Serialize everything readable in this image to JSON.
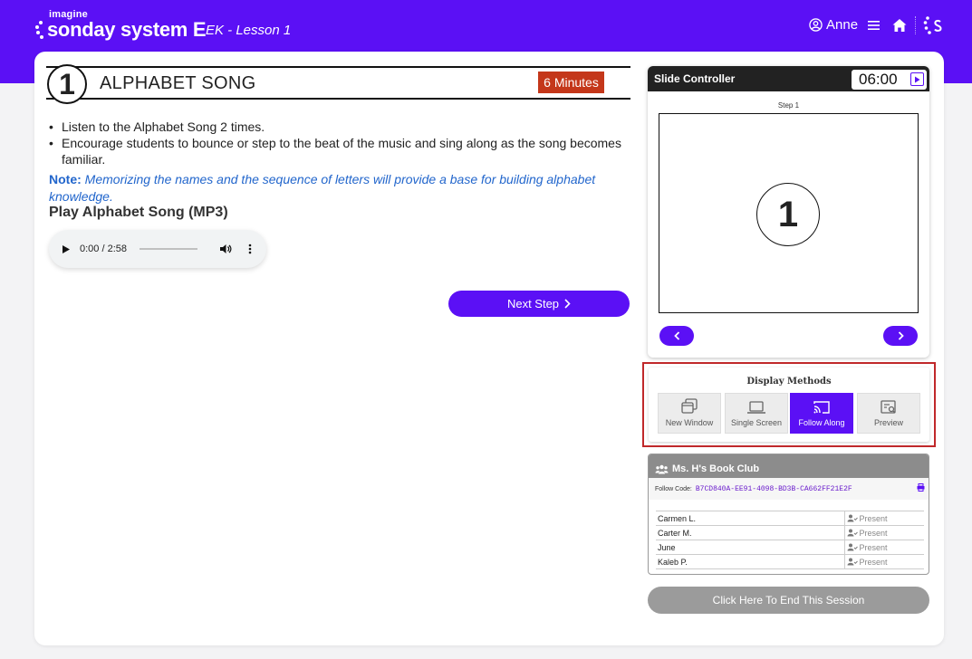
{
  "header": {
    "brand_small": "imagine",
    "brand_name": "sonday system",
    "brand_letter": "E",
    "lesson": "EK - Lesson 1",
    "user_name": "Anne"
  },
  "step": {
    "number": "1",
    "title": "ALPHABET SONG",
    "duration": "6 Minutes",
    "bullets": [
      "Listen to the Alphabet Song 2 times.",
      "Encourage students to bounce or step to the beat of the music and sing along as the song becomes familiar."
    ],
    "note_label": "Note:",
    "note_text": "Memorizing the names and the sequence of letters will provide a base for building alphabet knowledge.",
    "play_label": "Play Alphabet Song (MP3)",
    "audio_time": "0:00 / 2:58",
    "next_label": "Next Step"
  },
  "slide_controller": {
    "title": "Slide Controller",
    "timer": "06:00",
    "step_label": "Step 1",
    "slide_number": "1"
  },
  "display_methods": {
    "title": "Display Methods",
    "options": [
      "New Window",
      "Single Screen",
      "Follow Along",
      "Preview"
    ],
    "active": "Follow Along"
  },
  "club": {
    "title": "Ms. H's Book Club",
    "follow_label": "Follow Code:",
    "follow_code": "B7CD840A-EE91-4098-BD3B-CA662FF21E2F",
    "students": [
      {
        "name": "Carmen L.",
        "status": "Present"
      },
      {
        "name": "Carter M.",
        "status": "Present"
      },
      {
        "name": "June",
        "status": "Present"
      },
      {
        "name": "Kaleb P.",
        "status": "Present"
      }
    ]
  },
  "end_session_label": "Click Here To End This Session",
  "colors": {
    "brand": "#5b10f5",
    "duration_badge": "#c4371a",
    "highlight_border": "#c0282a",
    "note": "#2266cc"
  }
}
